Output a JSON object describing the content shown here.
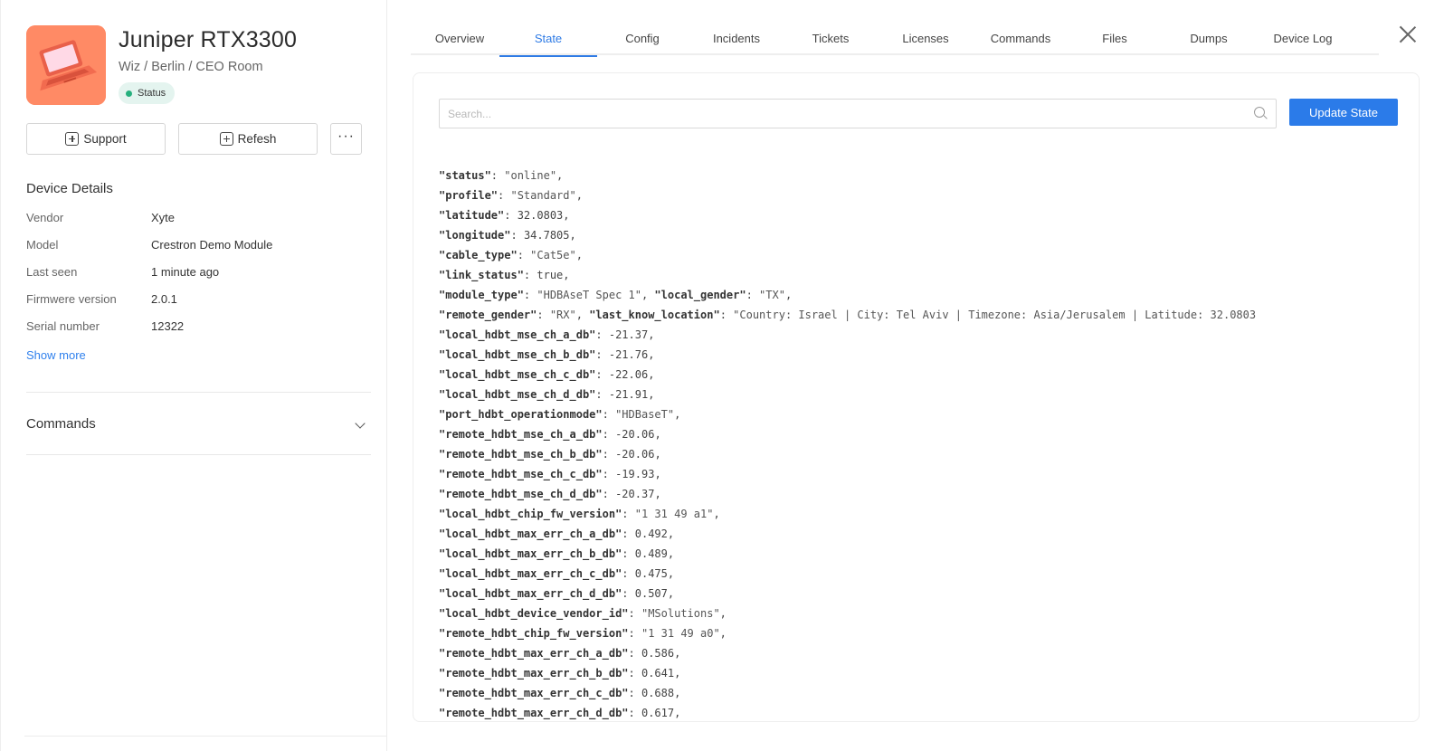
{
  "device": {
    "name": "Juniper RTX3300",
    "path": "Wiz / Berlin / CEO Room",
    "status_label": "Status"
  },
  "actions": {
    "support_label": "Support",
    "refresh_label": "Refesh",
    "more_label": "···"
  },
  "details": {
    "title": "Device Details",
    "rows": [
      {
        "label": "Vendor",
        "value": "Xyte"
      },
      {
        "label": "Model",
        "value": "Crestron Demo Module"
      },
      {
        "label": "Last seen",
        "value": "1 minute ago"
      },
      {
        "label": "Firmwere version",
        "value": "2.0.1"
      },
      {
        "label": "Serial number",
        "value": "12322"
      }
    ],
    "show_more": "Show more"
  },
  "commands": {
    "title": "Commands"
  },
  "tabs": [
    {
      "label": "Overview"
    },
    {
      "label": "State"
    },
    {
      "label": "Config"
    },
    {
      "label": "Incidents"
    },
    {
      "label": "Tickets"
    },
    {
      "label": "Licenses"
    },
    {
      "label": "Commands"
    },
    {
      "label": "Files"
    },
    {
      "label": "Dumps"
    },
    {
      "label": "Device Log"
    }
  ],
  "state": {
    "search_placeholder": "Search...",
    "update_label": "Update State",
    "lines": [
      [
        {
          "k": "status",
          "v": "\"online\"",
          "t": "s"
        }
      ],
      [
        {
          "k": "profile",
          "v": "\"Standard\"",
          "t": "s"
        }
      ],
      [
        {
          "k": "latitude",
          "v": "32.0803",
          "t": "n"
        }
      ],
      [
        {
          "k": "longitude",
          "v": "34.7805",
          "t": "n"
        }
      ],
      [
        {
          "k": "cable_type",
          "v": "\"Cat5e\"",
          "t": "s"
        }
      ],
      [
        {
          "k": "link_status",
          "v": "true",
          "t": "n"
        }
      ],
      [
        {
          "k": "module_type",
          "v": "\"HDBAseT Spec 1\"",
          "t": "s"
        },
        {
          "k": "local_gender",
          "v": "\"TX\"",
          "t": "s"
        }
      ],
      [
        {
          "k": "remote_gender",
          "v": "\"RX\"",
          "t": "s"
        },
        {
          "k": "last_know_location",
          "v": "\"Country: Israel | City: Tel Aviv | Timezone: Asia/Jerusalem | Latitude: 32.0803",
          "t": "s",
          "noend": true
        }
      ],
      [
        {
          "k": "local_hdbt_mse_ch_a_db",
          "v": "-21.37",
          "t": "n"
        }
      ],
      [
        {
          "k": "local_hdbt_mse_ch_b_db",
          "v": "-21.76",
          "t": "n"
        }
      ],
      [
        {
          "k": "local_hdbt_mse_ch_c_db",
          "v": "-22.06",
          "t": "n"
        }
      ],
      [
        {
          "k": "local_hdbt_mse_ch_d_db",
          "v": "-21.91",
          "t": "n"
        }
      ],
      [
        {
          "k": "port_hdbt_operationmode",
          "v": "\"HDBaseT\"",
          "t": "s"
        }
      ],
      [
        {
          "k": "remote_hdbt_mse_ch_a_db",
          "v": "-20.06",
          "t": "n"
        }
      ],
      [
        {
          "k": "remote_hdbt_mse_ch_b_db",
          "v": "-20.06",
          "t": "n"
        }
      ],
      [
        {
          "k": "remote_hdbt_mse_ch_c_db",
          "v": "-19.93",
          "t": "n"
        }
      ],
      [
        {
          "k": "remote_hdbt_mse_ch_d_db",
          "v": "-20.37",
          "t": "n"
        }
      ],
      [
        {
          "k": "local_hdbt_chip_fw_version",
          "v": "\"1 31 49 a1\"",
          "t": "s"
        }
      ],
      [
        {
          "k": "local_hdbt_max_err_ch_a_db",
          "v": "0.492",
          "t": "n"
        }
      ],
      [
        {
          "k": "local_hdbt_max_err_ch_b_db",
          "v": "0.489",
          "t": "n"
        }
      ],
      [
        {
          "k": "local_hdbt_max_err_ch_c_db",
          "v": "0.475",
          "t": "n"
        }
      ],
      [
        {
          "k": "local_hdbt_max_err_ch_d_db",
          "v": "0.507",
          "t": "n"
        }
      ],
      [
        {
          "k": "local_hdbt_device_vendor_id",
          "v": "\"MSolutions\"",
          "t": "s"
        }
      ],
      [
        {
          "k": "remote_hdbt_chip_fw_version",
          "v": "\"1 31 49 a0\"",
          "t": "s"
        }
      ],
      [
        {
          "k": "remote_hdbt_max_err_ch_a_db",
          "v": "0.586",
          "t": "n"
        }
      ],
      [
        {
          "k": "remote_hdbt_max_err_ch_b_db",
          "v": "0.641",
          "t": "n"
        }
      ],
      [
        {
          "k": "remote_hdbt_max_err_ch_c_db",
          "v": "0.688",
          "t": "n"
        }
      ],
      [
        {
          "k": "remote_hdbt_max_err_ch_d_db",
          "v": "0.617",
          "t": "n"
        }
      ]
    ]
  },
  "colors": {
    "accent": "#2b7be9",
    "status_dot": "#25b07d",
    "thumbnail": "#ff8a65"
  },
  "active_tab": "State"
}
